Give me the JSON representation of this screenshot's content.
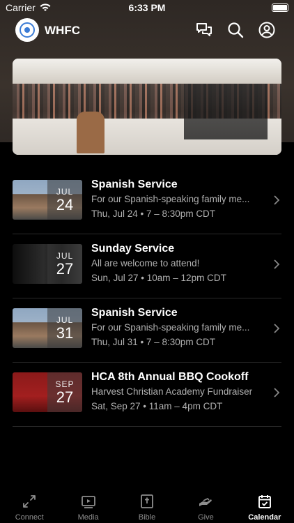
{
  "status_bar": {
    "carrier": "Carrier",
    "time": "6:33 PM"
  },
  "header": {
    "title": "WHFC"
  },
  "events": [
    {
      "thumb_month": "JUL",
      "thumb_day": "24",
      "title": "Spanish Service",
      "description": "For our Spanish-speaking family me...",
      "time": "Thu, Jul 24 • 7 – 8:30pm CDT"
    },
    {
      "thumb_month": "JUL",
      "thumb_day": "27",
      "title": "Sunday Service",
      "description": "All are welcome to attend!",
      "time": "Sun, Jul 27 • 10am – 12pm CDT"
    },
    {
      "thumb_month": "JUL",
      "thumb_day": "31",
      "title": "Spanish Service",
      "description": "For our Spanish-speaking family me...",
      "time": "Thu, Jul 31 • 7 – 8:30pm CDT"
    },
    {
      "thumb_month": "SEP",
      "thumb_day": "27",
      "title": "HCA 8th Annual BBQ Cookoff",
      "description": "Harvest Christian Academy Fundraiser",
      "time": "Sat, Sep 27 • 11am – 4pm CDT"
    }
  ],
  "tabbar": {
    "items": [
      {
        "label": "Connect",
        "icon": "connect-icon"
      },
      {
        "label": "Media",
        "icon": "media-icon"
      },
      {
        "label": "Bible",
        "icon": "bible-icon"
      },
      {
        "label": "Give",
        "icon": "give-icon"
      },
      {
        "label": "Calendar",
        "icon": "calendar-icon",
        "active": true
      }
    ]
  },
  "colors": {
    "background": "#000000",
    "header_bg": "#2e2824",
    "muted_text": "#b0b0b0",
    "tab_inactive": "#8e8e8e"
  }
}
